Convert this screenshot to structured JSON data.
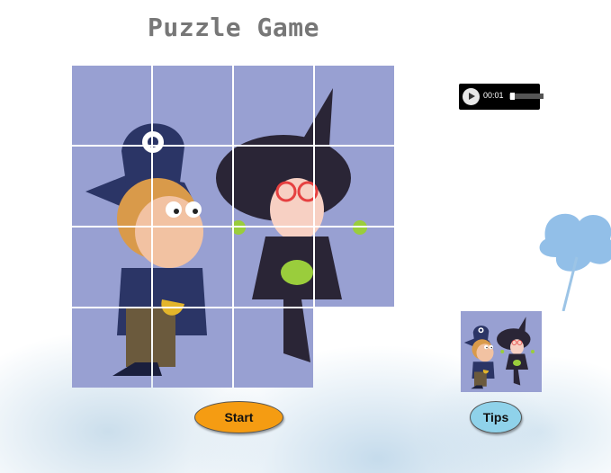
{
  "title": "Puzzle Game",
  "audio": {
    "time": "00:01",
    "progress": 0.03
  },
  "buttons": {
    "start_label": "Start",
    "tips_label": "Tips"
  },
  "board": {
    "rows": 4,
    "cols": 4,
    "empty_tile": {
      "row": 4,
      "col": 4
    }
  },
  "colors": {
    "board_bg": "#98a0d2",
    "start": "#f59c12",
    "tips": "#8fd2ea"
  }
}
